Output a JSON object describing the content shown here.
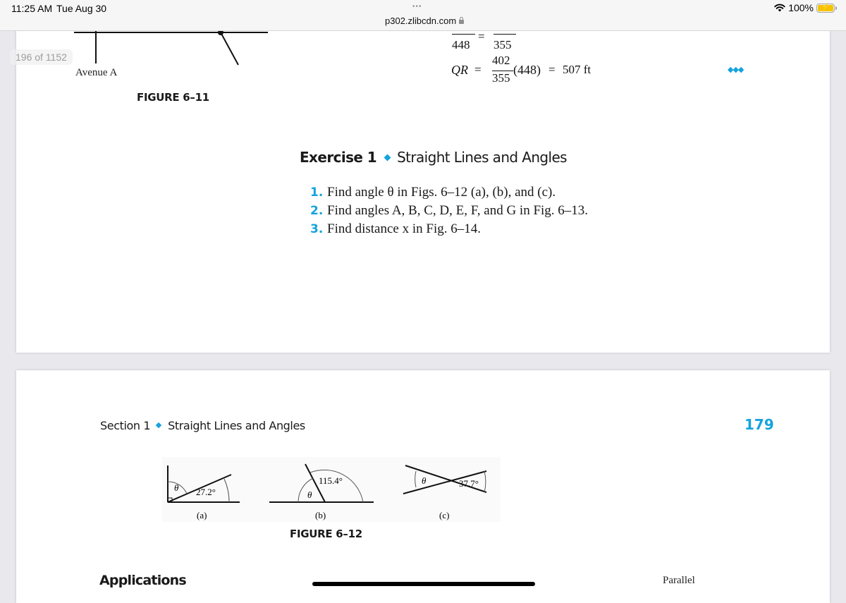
{
  "status_bar": {
    "time": "11:25 AM",
    "date": "Tue Aug 30",
    "url": "p302.zlibcdn.com",
    "tab_dots": "•••",
    "battery": "100%",
    "battery_color": "#f5c400",
    "icons": [
      "wifi-icon",
      "battery-charging-icon",
      "lock-icon"
    ]
  },
  "viewer": {
    "page_counter": "196 of 1152",
    "menu_dots": "◆◆◆",
    "accent_color": "#14a3dd"
  },
  "page_top": {
    "figure_label_street": "Avenue A",
    "figure_caption": "FIGURE 6–11",
    "equation1": {
      "left_den": "448",
      "equals": "=",
      "right_den": "355"
    },
    "equation2": {
      "lhs": "QR",
      "equals": "=",
      "num": "402",
      "den": "355",
      "multiplier": "(448)",
      "equals2": "=",
      "result": "507 ft"
    },
    "exercise": {
      "label": "Exercise 1",
      "title": "Straight Lines and Angles",
      "items": [
        {
          "num": "1.",
          "text": "Find angle θ in Figs. 6–12 (a), (b), and (c)."
        },
        {
          "num": "2.",
          "text": "Find angles A, B, C, D, E, F, and G in Fig. 6–13."
        },
        {
          "num": "3.",
          "text": "Find distance x in Fig. 6–14."
        }
      ]
    }
  },
  "page_bottom": {
    "section_label": "Section 1",
    "section_title": "Straight Lines and Angles",
    "page_number": "179",
    "figure": {
      "caption": "FIGURE 6–12",
      "parts": [
        {
          "label": "(a)",
          "theta": "θ",
          "angle": "27.2°"
        },
        {
          "label": "(b)",
          "theta": "θ",
          "angle": "115.4°"
        },
        {
          "label": "(c)",
          "theta": "θ",
          "angle": "37.7°"
        }
      ]
    },
    "applications_heading": "Applications",
    "next_figure_label": "Parallel"
  }
}
